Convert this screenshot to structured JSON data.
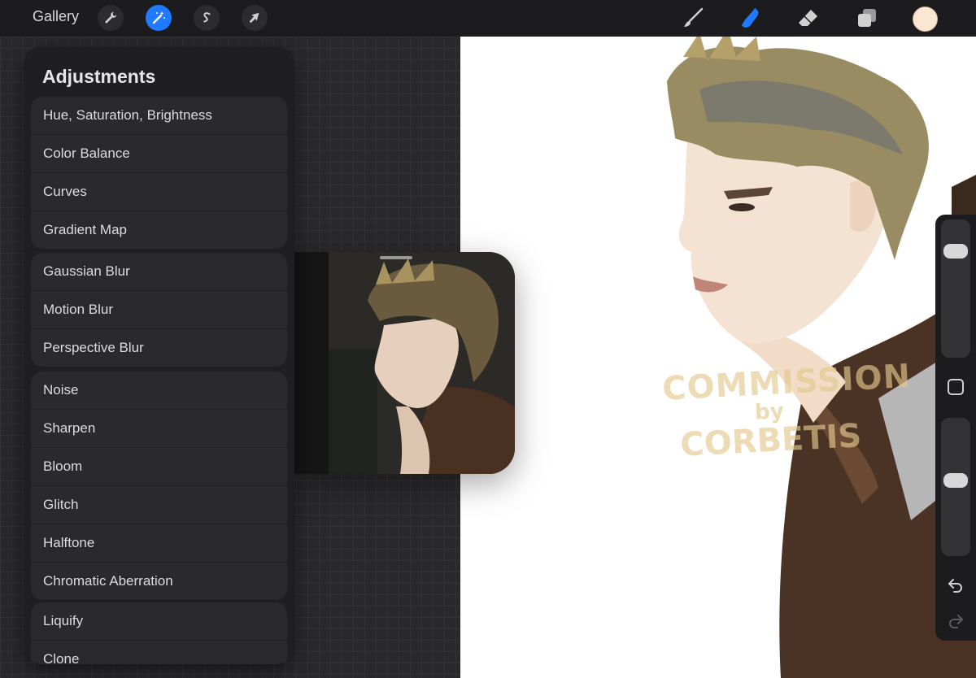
{
  "topbar": {
    "gallery_label": "Gallery",
    "left_tools": [
      {
        "icon": "wrench-icon",
        "label": "Actions"
      },
      {
        "icon": "magic-wand-icon",
        "label": "Adjustments",
        "active": true
      },
      {
        "icon": "selection-s-icon",
        "label": "Selection"
      },
      {
        "icon": "arrow-cursor-icon",
        "label": "Transform"
      }
    ],
    "right_tools": [
      {
        "icon": "brush-icon"
      },
      {
        "icon": "smudge-icon",
        "active": true
      },
      {
        "icon": "eraser-icon"
      },
      {
        "icon": "layers-icon"
      }
    ],
    "color_swatch": "#fbe6d2",
    "accent": "#1f7aff"
  },
  "adjustments": {
    "title": "Adjustments",
    "groups": [
      [
        "Hue, Saturation, Brightness",
        "Color Balance",
        "Curves",
        "Gradient Map"
      ],
      [
        "Gaussian Blur",
        "Motion Blur",
        "Perspective Blur"
      ],
      [
        "Noise",
        "Sharpen",
        "Bloom",
        "Glitch",
        "Halftone",
        "Chromatic Aberration"
      ],
      [
        "Liquify",
        "Clone"
      ]
    ]
  },
  "canvas": {
    "watermark_line1": "COMMISSION",
    "watermark_line2": "by",
    "watermark_line3": "CORBETIS"
  },
  "sidebar": {
    "brush_size_level": 0.8,
    "opacity_level": 0.55,
    "undo_icon": "undo-icon",
    "redo_icon": "redo-icon",
    "modify_icon": "square-modify-icon"
  }
}
